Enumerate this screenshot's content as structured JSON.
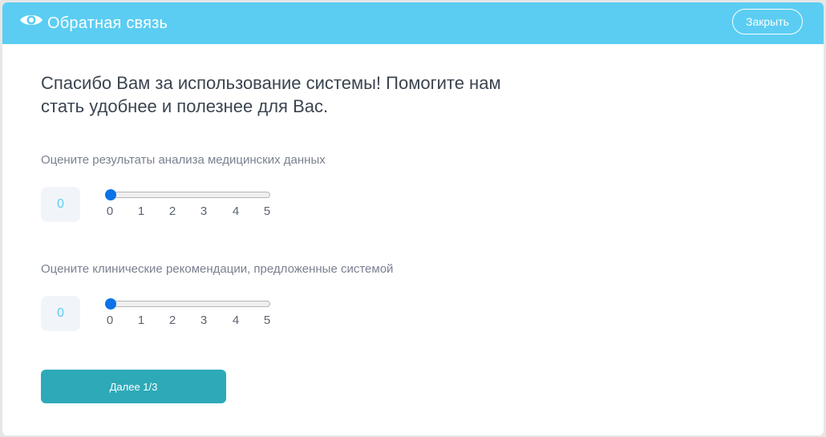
{
  "header": {
    "icon": "eye-icon",
    "title": "Обратная связь",
    "close_label": "Закрыть"
  },
  "intro": "Спасибо Вам за использование системы! Помогите нам стать удобнее и полезнее для Вас.",
  "questions": [
    {
      "label": "Оцените результаты анализа медицинских данных",
      "value": "0",
      "min": 0,
      "max": 5,
      "ticks": [
        "0",
        "1",
        "2",
        "3",
        "4",
        "5"
      ]
    },
    {
      "label": "Оцените клинические рекомендации, предложенные системой",
      "value": "0",
      "min": 0,
      "max": 5,
      "ticks": [
        "0",
        "1",
        "2",
        "3",
        "4",
        "5"
      ]
    }
  ],
  "next_label": "Далее 1/3",
  "colors": {
    "header_bg": "#5bcdf2",
    "primary_button": "#2ea9b8",
    "slider_thumb": "#0b72e7",
    "score_text": "#5bcdf2"
  }
}
